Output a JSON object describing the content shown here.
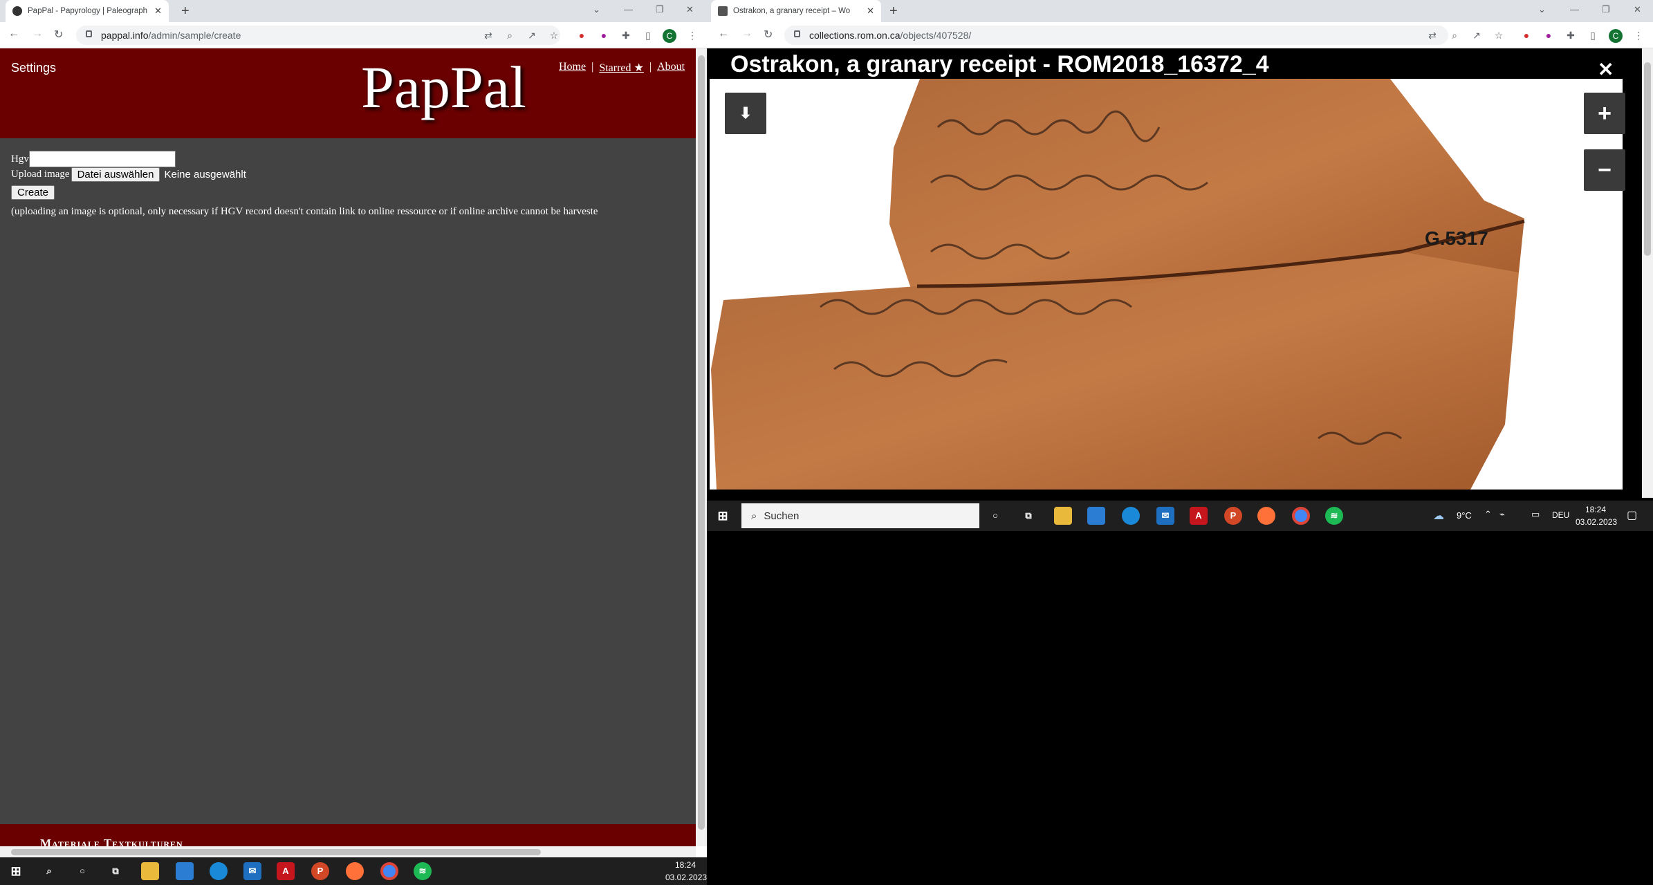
{
  "left_browser": {
    "tab_title": "PapPal - Papyrology | Paleograph",
    "url_host": "pappal.info",
    "url_path": "/admin/sample/create",
    "page": {
      "settings_label": "Settings",
      "logo_text": "PapPal",
      "nav": [
        "Home",
        "|",
        "Starred ★",
        "|",
        "About"
      ],
      "hgv_label": "Hgv",
      "hgv_value": "",
      "upload_label": "Upload image",
      "file_button": "Datei auswählen",
      "file_status": "Keine ausgewählt",
      "create_button": "Create",
      "note": "(uploading an image is optional, only necessary if HGV record doesn't contain link to online ressource or if online archive cannot be harveste",
      "footer_text": "Materiale Textkulturen"
    },
    "avatar_letter": "C",
    "taskbar": {
      "time": "18:24",
      "date": "03.02.2023"
    }
  },
  "right_browser": {
    "tab_title": "Ostrakon, a granary receipt – Wo",
    "url_host": "collections.rom.on.ca",
    "url_path": "/objects/407528/",
    "viewer_title": "Ostrakon, a granary receipt - ROM2018_16372_4",
    "close_glyph": "✕",
    "zoom_in_glyph": "+",
    "zoom_out_glyph": "−",
    "download_glyph": "⬇",
    "label_on_artifact": "G.5317",
    "avatar_letter": "C",
    "taskbar": {
      "search_placeholder": "Suchen",
      "weather": "9°C",
      "language": "DEU",
      "time": "18:24",
      "date": "03.02.2023"
    }
  },
  "colors": {
    "header_red": "#6b0000",
    "content_gray": "#434343",
    "taskbar": "#1f1f1f"
  }
}
